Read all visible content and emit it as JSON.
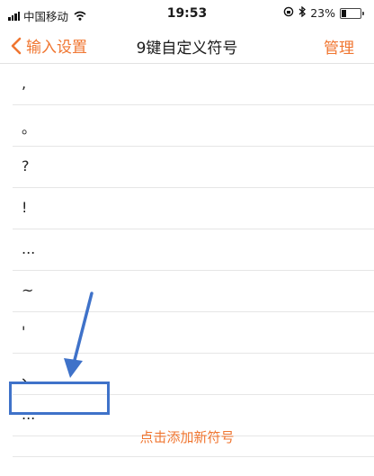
{
  "status_bar": {
    "carrier": "中国移动",
    "time": "19:53",
    "battery_percent": "23%",
    "battery_level": 0.23,
    "icons": [
      "signal-bars-icon",
      "wifi-icon",
      "rotation-lock-icon",
      "bluetooth-icon",
      "battery-icon"
    ]
  },
  "nav": {
    "back_label": "输入设置",
    "title": "9键自定义符号",
    "manage_label": "管理"
  },
  "symbols": [
    ",",
    "。",
    "?",
    "!",
    "...",
    "~",
    "'",
    "、",
    "..."
  ],
  "add_symbol_label": "点击添加新符号",
  "colors": {
    "accent": "#f07631",
    "annotation": "#3f72c9"
  }
}
